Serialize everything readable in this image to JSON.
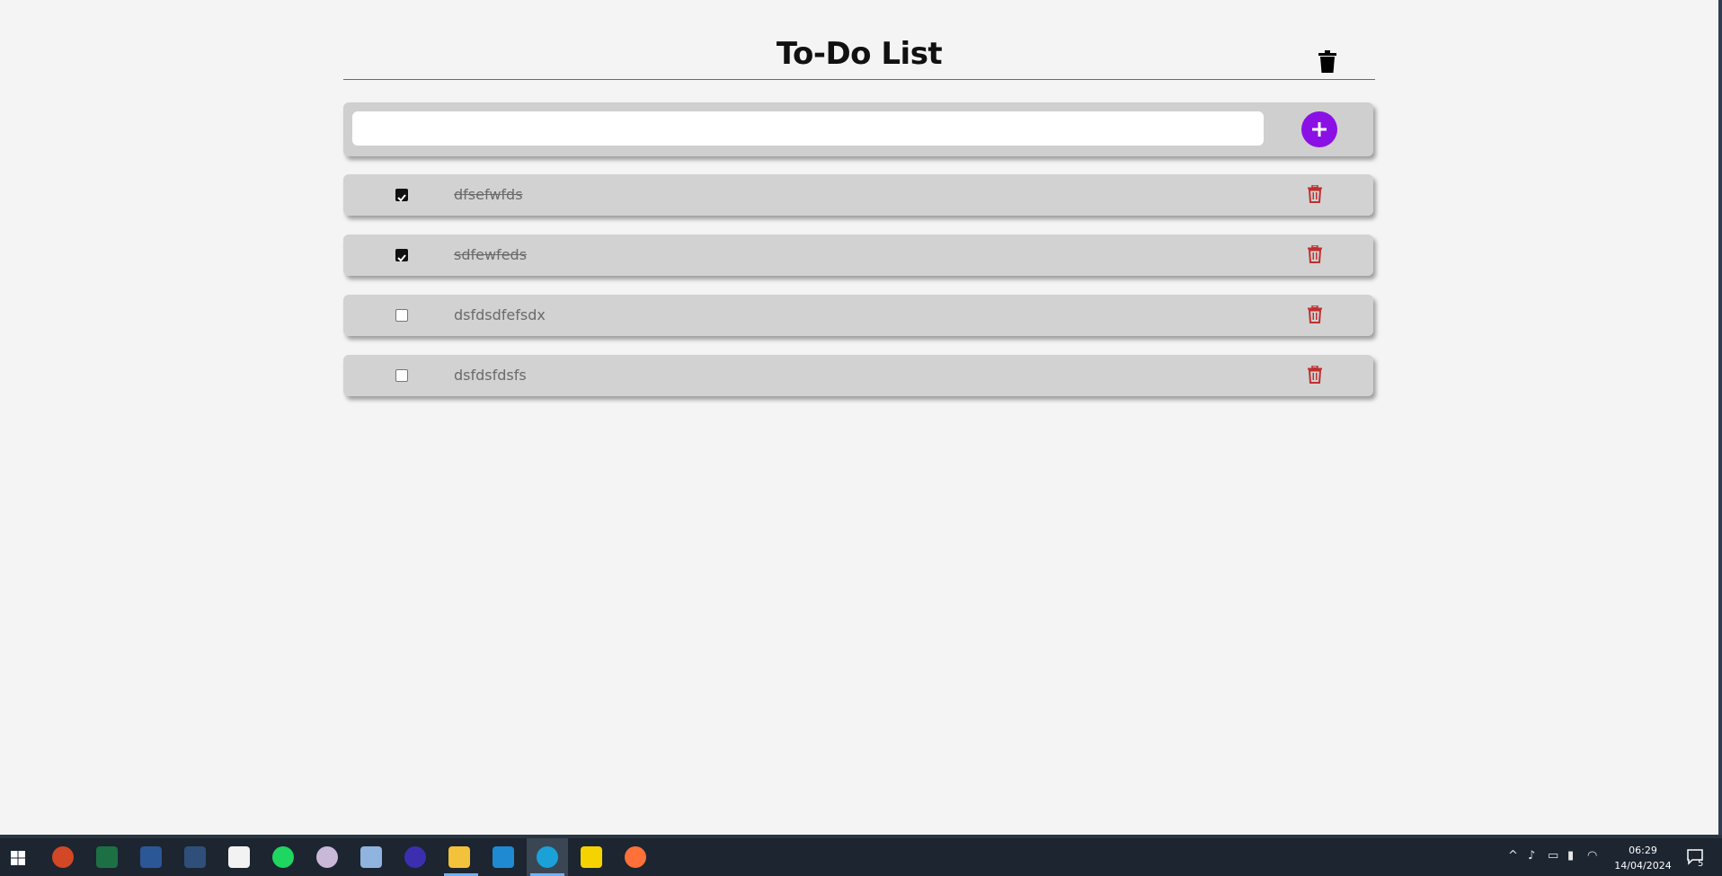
{
  "app": {
    "title": "To-Do List"
  },
  "input": {
    "value": "",
    "placeholder": ""
  },
  "todos": [
    {
      "text": "dfsefwfds",
      "done": true
    },
    {
      "text": "sdfewfeds",
      "done": true
    },
    {
      "text": "dsfdsdfefsdx",
      "done": false
    },
    {
      "text": "dsfdsfdsfs",
      "done": false
    }
  ],
  "colors": {
    "accent": "#8b10e6",
    "delete": "#c03030",
    "page_bg": "#f4f4f4",
    "card_bg": "#d2d2d2"
  },
  "taskbar": {
    "apps": [
      "windows-start-icon",
      "powerpoint-icon",
      "excel-icon",
      "word-icon",
      "app-icon",
      "store-icon",
      "spotify-icon",
      "paint-icon",
      "remote-desktop-icon",
      "browser-app-icon",
      "file-explorer-icon",
      "vscode-icon",
      "edge-icon",
      "sticky-app-icon",
      "firefox-icon"
    ],
    "time": "06:29",
    "date": "14/04/2024",
    "notification_count": "5"
  }
}
